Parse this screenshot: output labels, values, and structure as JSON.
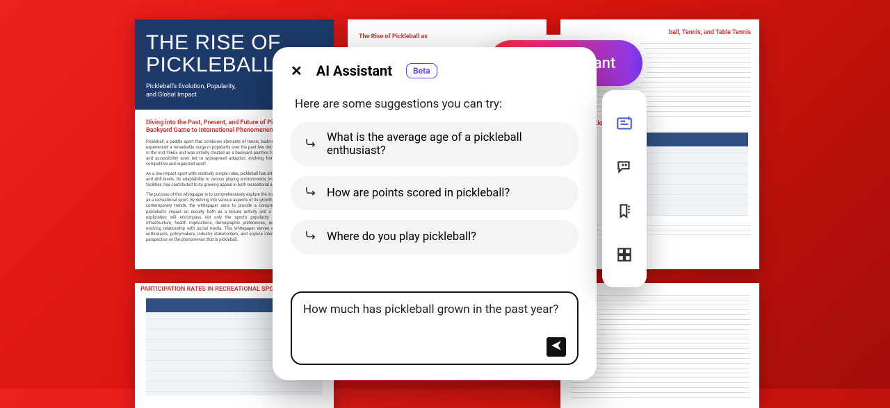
{
  "doc": {
    "cover_title_line1": "THE RISE OF",
    "cover_title_line2": "PICKLEBALL",
    "cover_subtitle": "Pickleball's Evolution, Popularity, and Global Impact",
    "section_heading": "Diving into the Past, Present, and Future of Pickleball: From Backyard Game to International Phenomenon",
    "mid_heading": "The Rise of Pickleball as",
    "right_heading": "ball, Tennis, and Table Tennis",
    "right_table_heading": "Participation",
    "left_table_heading": "PARTICIPATION RATES IN RECREATIONAL SPORTS"
  },
  "pill": {
    "label": "AI Assistant"
  },
  "panel": {
    "title": "AI Assistant",
    "badge": "Beta",
    "intro": "Here are some suggestions you can try:",
    "suggestions": [
      "What is the average age of a pickleball enthusiast?",
      "How are points scored in pickleball?",
      "Where do you play pickleball?"
    ],
    "input_value": "How much has pickleball grown in the past year?"
  },
  "rail": {
    "items": [
      "summary-card-icon",
      "chat-icon",
      "bookmark-icon",
      "grid-icon"
    ]
  }
}
